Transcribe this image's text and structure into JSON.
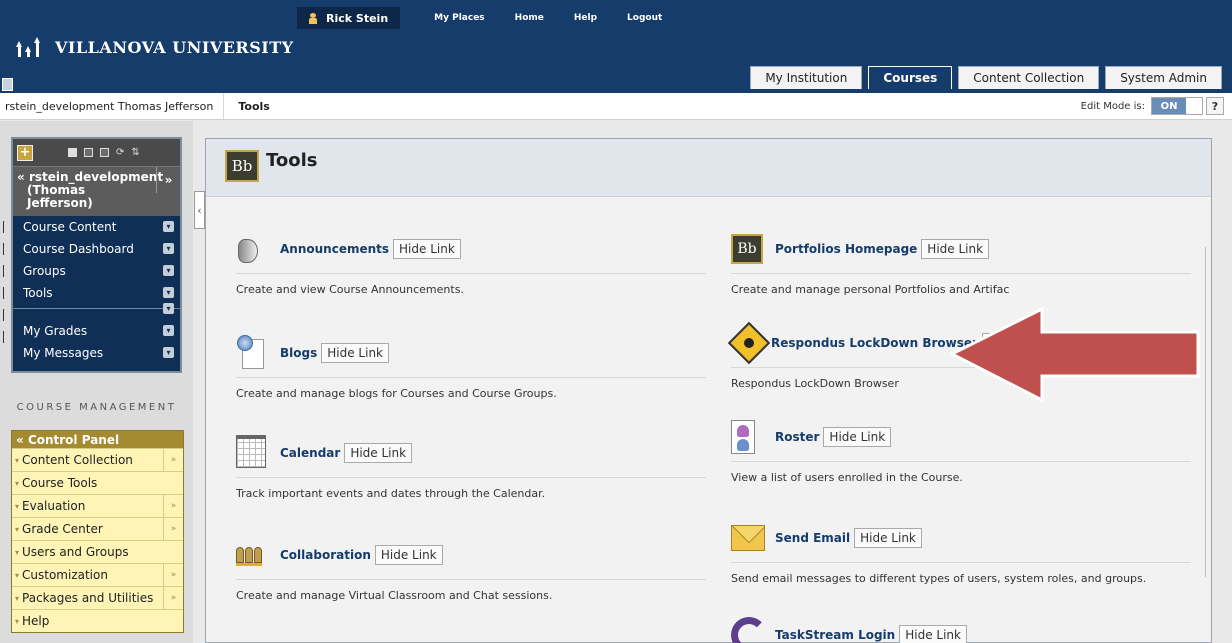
{
  "header": {
    "university": "VILLANOVA UNIVERSITY",
    "user_name": "Rick Stein",
    "links": [
      "My Places",
      "Home",
      "Help",
      "Logout"
    ],
    "tabs": [
      {
        "label": "My Institution",
        "active": false
      },
      {
        "label": "Courses",
        "active": true
      },
      {
        "label": "Content Collection",
        "active": false
      },
      {
        "label": "System Admin",
        "active": false
      }
    ]
  },
  "breadcrumb": {
    "course": "rstein_development Thomas Jefferson",
    "page": "Tools"
  },
  "edit_mode": {
    "label": "Edit Mode is:",
    "state": "ON",
    "help": "?"
  },
  "course_menu": {
    "add_symbol": "+",
    "title_line1": "rstein_development",
    "title_line2": "(Thomas",
    "title_line3": "Jefferson)",
    "items": [
      "Course Content",
      "Course Dashboard",
      "Groups",
      "Tools",
      "My Grades",
      "My Messages"
    ]
  },
  "course_management": {
    "label": "COURSE MANAGEMENT",
    "control_panel": "Control Panel",
    "items": [
      {
        "label": "Content Collection",
        "more": true
      },
      {
        "label": "Course Tools",
        "more": false
      },
      {
        "label": "Evaluation",
        "more": true
      },
      {
        "label": "Grade Center",
        "more": true
      },
      {
        "label": "Users and Groups",
        "more": false
      },
      {
        "label": "Customization",
        "more": true
      },
      {
        "label": "Packages and Utilities",
        "more": true
      },
      {
        "label": "Help",
        "more": false
      }
    ]
  },
  "main": {
    "title": "Tools",
    "bb_logo": "Bb",
    "hide_label": "Hide Link",
    "tools_left": [
      {
        "name": "Announcements",
        "desc": "Create and view Course Announcements.",
        "icon": "megaphone-icon"
      },
      {
        "name": "Blogs",
        "desc": "Create and manage blogs for Courses and Course Groups.",
        "icon": "blog-icon"
      },
      {
        "name": "Calendar",
        "desc": "Track important events and dates through the Calendar.",
        "icon": "calendar-icon"
      },
      {
        "name": "Collaboration",
        "desc": "Create and manage Virtual Classroom and Chat sessions.",
        "icon": "collaboration-icon"
      }
    ],
    "tools_right": [
      {
        "name": "Portfolios Homepage",
        "desc": "Create and manage personal Portfolios and Artifac",
        "icon": "blackboard-icon"
      },
      {
        "name": "Respondus LockDown Browser",
        "desc": "Respondus LockDown Browser",
        "icon": "lockdown-icon",
        "hide": "H"
      },
      {
        "name": "Roster",
        "desc": "View a list of users enrolled in the Course.",
        "icon": "roster-icon"
      },
      {
        "name": "Send Email",
        "desc": "Send email messages to different types of users, system roles, and groups.",
        "icon": "envelope-icon"
      },
      {
        "name": "TaskStream Login",
        "desc": "",
        "icon": "taskstream-icon"
      }
    ]
  },
  "colors": {
    "header_bg": "#153c6b",
    "link_blue": "#153c6b",
    "control_panel_bg": "#fdf4b6",
    "arrow_red": "#c0504d"
  }
}
